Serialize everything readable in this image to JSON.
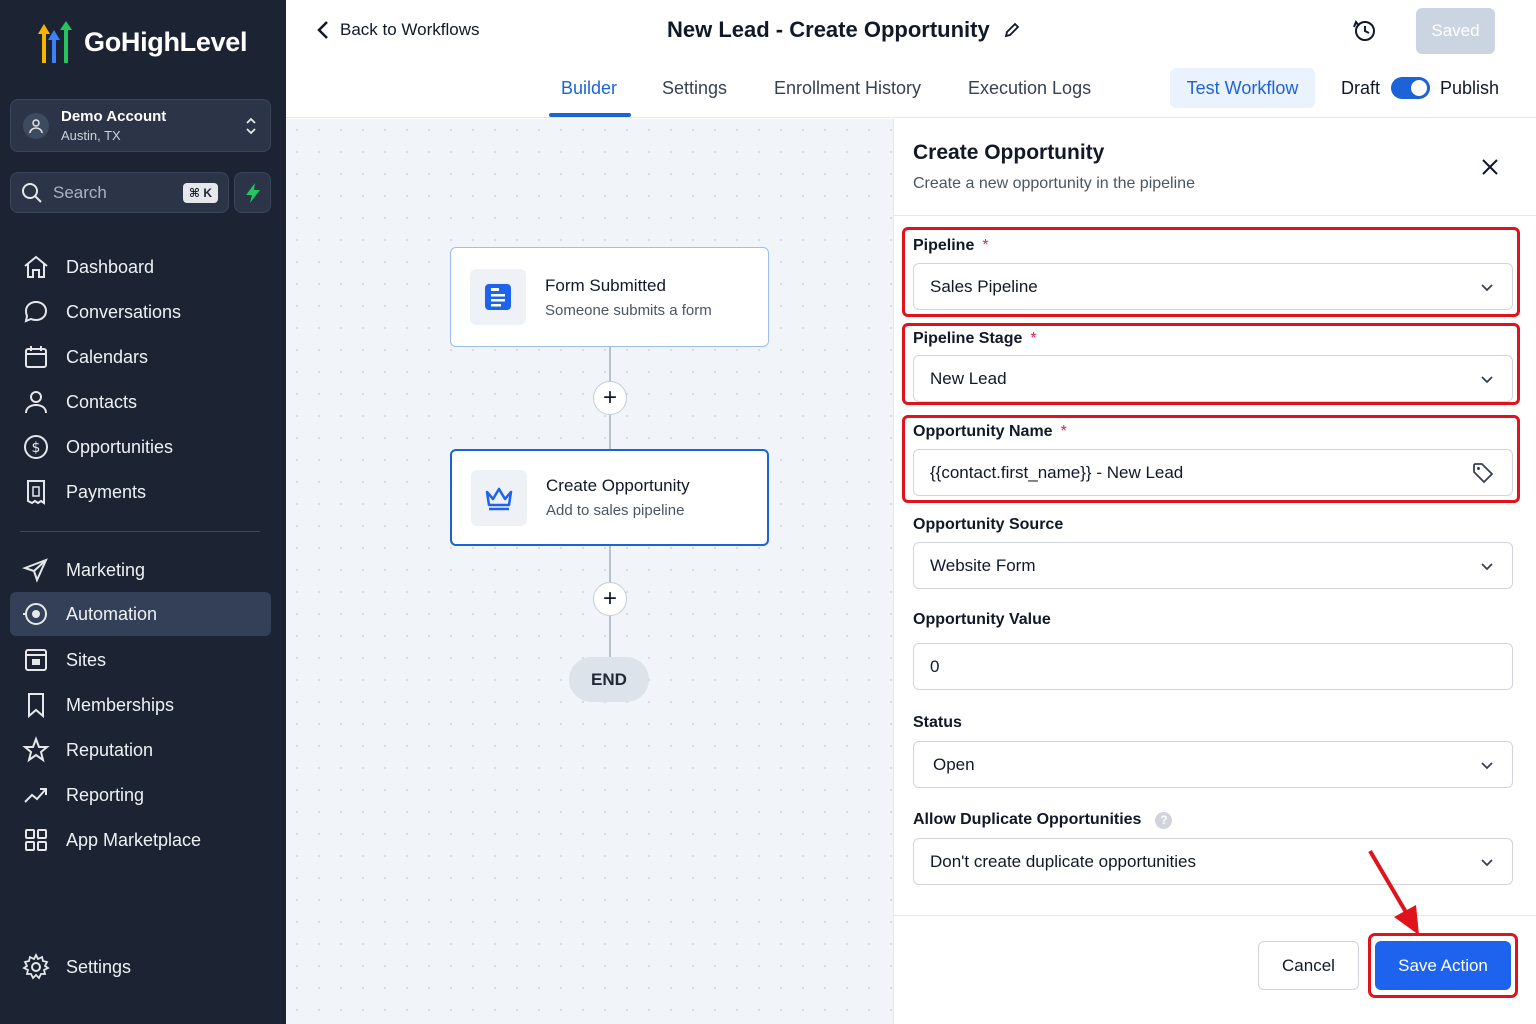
{
  "app": {
    "brand": "GoHighLevel",
    "colors": {
      "sidebar_bg": "#1c2433",
      "accent": "#1d63d8",
      "highlight": "#e0121b"
    }
  },
  "sidebar": {
    "account": {
      "name": "Demo Account",
      "location": "Austin, TX"
    },
    "search": {
      "label": "Search",
      "shortcut": "⌘ K"
    },
    "items": [
      {
        "label": "Dashboard",
        "icon": "home-icon"
      },
      {
        "label": "Conversations",
        "icon": "chat-icon"
      },
      {
        "label": "Calendars",
        "icon": "calendar-icon"
      },
      {
        "label": "Contacts",
        "icon": "user-icon"
      },
      {
        "label": "Opportunities",
        "icon": "dollar-icon"
      },
      {
        "label": "Payments",
        "icon": "receipt-icon"
      },
      {
        "label": "Marketing",
        "icon": "send-icon"
      },
      {
        "label": "Automation",
        "icon": "automation-icon",
        "active": true
      },
      {
        "label": "Sites",
        "icon": "sites-icon"
      },
      {
        "label": "Memberships",
        "icon": "bookmark-icon"
      },
      {
        "label": "Reputation",
        "icon": "star-icon"
      },
      {
        "label": "Reporting",
        "icon": "trend-icon"
      },
      {
        "label": "App Marketplace",
        "icon": "grid-icon"
      },
      {
        "label": "Settings",
        "icon": "gear-icon"
      }
    ]
  },
  "header": {
    "back_label": "Back to Workflows",
    "workflow_title": "New Lead - Create Opportunity",
    "saved_label": "Saved",
    "tabs": [
      {
        "label": "Builder",
        "active": true
      },
      {
        "label": "Settings"
      },
      {
        "label": "Enrollment History"
      },
      {
        "label": "Execution Logs"
      }
    ],
    "test_label": "Test Workflow",
    "draft_label": "Draft",
    "publish_label": "Publish",
    "publish_toggle_on": true
  },
  "canvas": {
    "nodes": [
      {
        "title": "Form Submitted",
        "subtitle": "Someone submits a form",
        "icon": "form-icon"
      },
      {
        "title": "Create Opportunity",
        "subtitle": "Add to sales pipeline",
        "icon": "crown-icon"
      }
    ],
    "add_symbol": "+",
    "end_label": "END"
  },
  "panel": {
    "title": "Create Opportunity",
    "subtitle": "Create a new opportunity in the pipeline",
    "required_mark": "*",
    "fields": {
      "pipeline": {
        "label": "Pipeline",
        "value": "Sales Pipeline"
      },
      "stage": {
        "label": "Pipeline Stage",
        "value": "New Lead"
      },
      "name": {
        "label": "Opportunity Name",
        "value": "{{contact.first_name}} - New Lead"
      },
      "source": {
        "label": "Opportunity Source",
        "value": "Website Form"
      },
      "value": {
        "label": "Opportunity Value",
        "value": "0"
      },
      "status": {
        "label": "Status",
        "value": "Open"
      },
      "duplicates": {
        "label": "Allow Duplicate Opportunities",
        "value": "Don't create duplicate opportunities",
        "help": "?"
      }
    },
    "cancel_label": "Cancel",
    "save_label": "Save Action"
  }
}
